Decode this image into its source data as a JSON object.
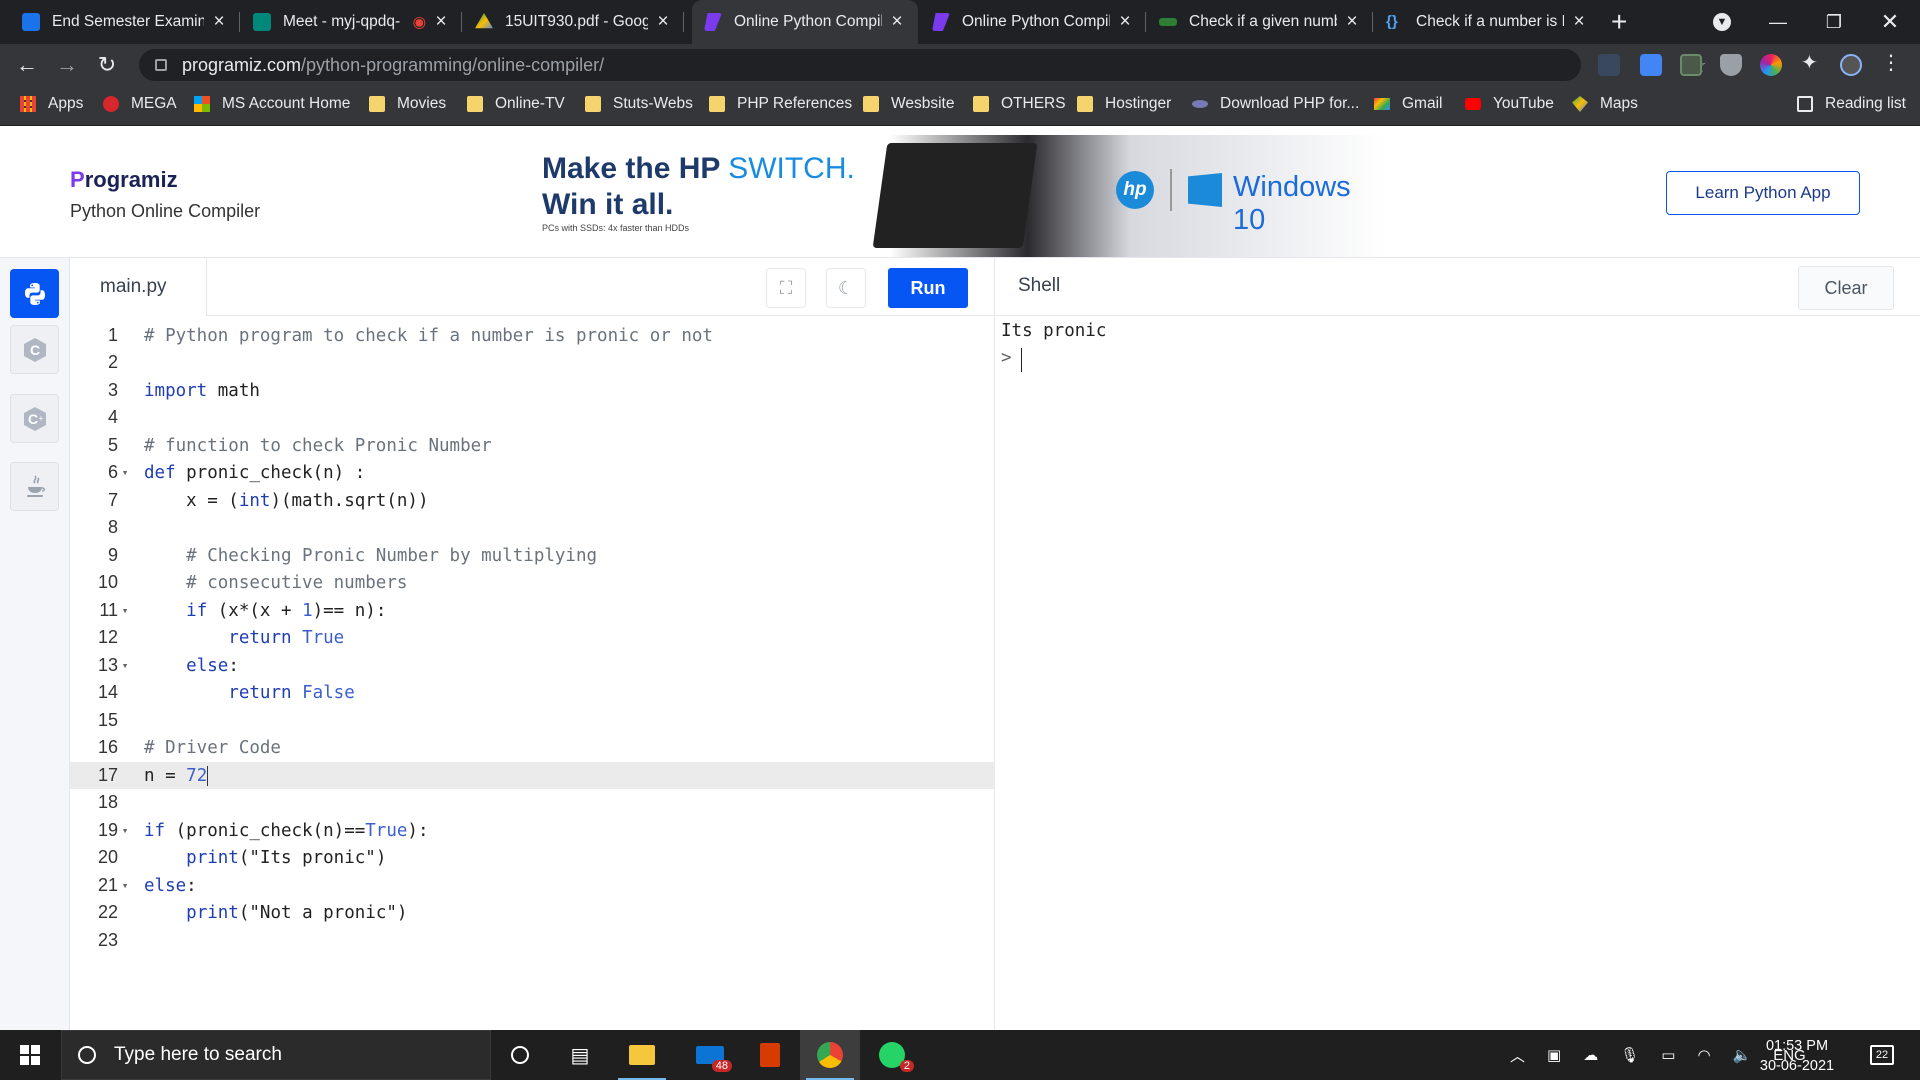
{
  "browser": {
    "tabs": [
      {
        "title": "End Semester Examina",
        "color": "#1a73e8"
      },
      {
        "title": "Meet - myj-qpdq-",
        "color": "#00897b"
      },
      {
        "title": "15UIT930.pdf - Googl",
        "color": "#fbbc04"
      },
      {
        "title": "Online Python Compil",
        "color": "#7c3aed"
      },
      {
        "title": "Online Python Compil",
        "color": "#7c3aed"
      },
      {
        "title": "Check if a given numb",
        "color": "#2e7d32"
      },
      {
        "title": "Check if a number is P",
        "color": "#1a73e8"
      }
    ],
    "address_host": "programiz.com",
    "address_path": "/python-programming/online-compiler/",
    "bookmarks": [
      {
        "label": "Apps",
        "icon": "apps-grid-icon"
      },
      {
        "label": "MEGA",
        "icon": "mega-icon"
      },
      {
        "label": "MS Account Home",
        "icon": "microsoft-icon"
      },
      {
        "label": "Movies",
        "icon": "folder-icon"
      },
      {
        "label": "Online-TV",
        "icon": "folder-icon"
      },
      {
        "label": "Stuts-Webs",
        "icon": "folder-icon"
      },
      {
        "label": "PHP References",
        "icon": "folder-icon"
      },
      {
        "label": "Wesbsite",
        "icon": "folder-icon"
      },
      {
        "label": "OTHERS",
        "icon": "folder-icon"
      },
      {
        "label": "Hostinger",
        "icon": "folder-icon"
      },
      {
        "label": "Download PHP for...",
        "icon": "php-icon"
      },
      {
        "label": "Gmail",
        "icon": "gmail-icon"
      },
      {
        "label": "YouTube",
        "icon": "youtube-icon"
      },
      {
        "label": "Maps",
        "icon": "maps-icon"
      }
    ],
    "reading_list": "Reading list"
  },
  "site": {
    "logo": "rogramiz",
    "logo_p": "P",
    "subtitle": "Python Online Compiler",
    "ad_line1_a": "Make the HP ",
    "ad_line1_b": "SWITCH.",
    "ad_line2": "Win it all.",
    "ad_fine": "PCs with SSDs: 4x faster than HDDs",
    "ad_hp": "hp",
    "ad_windows": "Windows 10",
    "learn_button": "Learn Python App",
    "accent": "#0556f3"
  },
  "editor": {
    "filename": "main.py",
    "run_label": "Run",
    "lines": [
      "# Python program to check if a number is pronic or not",
      "",
      "import math",
      "",
      "# function to check Pronic Number",
      "def pronic_check(n) :",
      "    x = (int)(math.sqrt(n))",
      "",
      "    # Checking Pronic Number by multiplying",
      "    # consecutive numbers",
      "    if (x*(x + 1)== n):",
      "        return True",
      "    else:",
      "        return False",
      "",
      "# Driver Code",
      "n = 72",
      "",
      "if (pronic_check(n)==True):",
      "    print(\"Its pronic\")",
      "else:",
      "    print(\"Not a pronic\")",
      ""
    ],
    "highlighted_line": 17
  },
  "shell": {
    "title": "Shell",
    "clear_label": "Clear",
    "output": "Its pronic",
    "prompt": ">"
  },
  "taskbar": {
    "search_placeholder": "Type here to search",
    "mail_badge": "48",
    "whatsapp_badge": "2",
    "lang": "ENG",
    "time": "01:53 PM",
    "date": "30-06-2021",
    "notifications": "22"
  }
}
